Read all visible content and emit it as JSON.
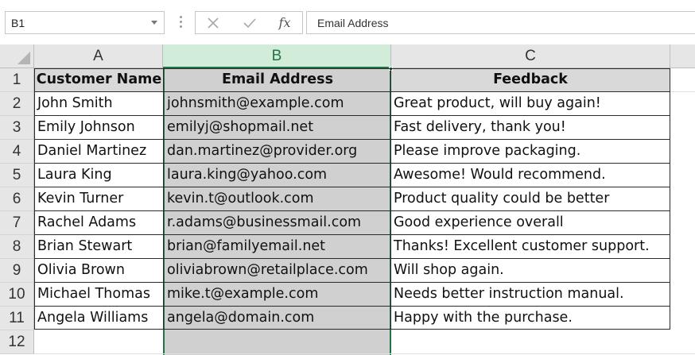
{
  "formula_bar": {
    "name_box": "B1",
    "cancel_icon": "close-icon",
    "enter_icon": "checkmark-icon",
    "function_label": "fx",
    "content": "Email Address"
  },
  "columns": [
    "A",
    "B",
    "C"
  ],
  "rows": [
    "1",
    "2",
    "3",
    "4",
    "5",
    "6",
    "7",
    "8",
    "9",
    "10",
    "11",
    "12"
  ],
  "sheet": {
    "headers": [
      "Customer Name",
      "Email Address",
      "Feedback"
    ],
    "data": [
      [
        "John Smith",
        "johnsmith@example.com",
        "Great product, will buy again!"
      ],
      [
        "Emily Johnson",
        "emilyj@shopmail.net",
        "Fast delivery, thank you!"
      ],
      [
        "Daniel Martinez",
        "dan.martinez@provider.org",
        "Please improve packaging."
      ],
      [
        "Laura King",
        "laura.king@yahoo.com",
        "Awesome! Would recommend."
      ],
      [
        "Kevin Turner",
        "kevin.t@outlook.com",
        "Product quality could be better"
      ],
      [
        "Rachel Adams",
        "r.adams@businessmail.com",
        "Good experience overall"
      ],
      [
        "Brian Stewart",
        "brian@familyemail.net",
        "Thanks! Excellent customer support."
      ],
      [
        "Olivia Brown",
        "oliviabrown@retailplace.com",
        "Will shop again."
      ],
      [
        "Michael Thomas",
        "mike.t@example.com",
        "Needs better instruction manual."
      ],
      [
        "Angela Williams",
        "angela@domain.com",
        "Happy with the purchase."
      ]
    ]
  },
  "colors": {
    "selection_accent": "#217346",
    "selected_header_bg": "#d2ecda",
    "selected_column_fill": "#d0d0d0",
    "header_row_fill": "#d9d9d9"
  }
}
